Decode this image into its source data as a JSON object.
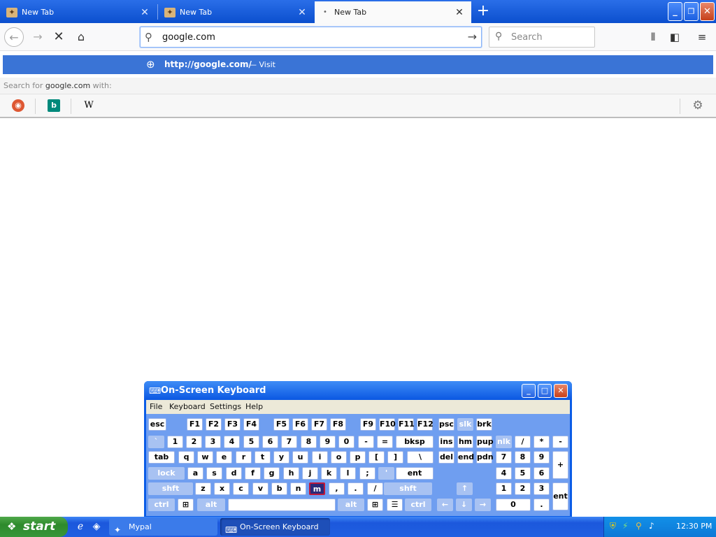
{
  "browser": {
    "tabs": [
      {
        "title": "New Tab",
        "active": false
      },
      {
        "title": "New Tab",
        "active": false
      },
      {
        "title": "New Tab",
        "active": true
      }
    ],
    "new_tab_symbol": "+",
    "url_value": "google.com",
    "search_placeholder": "Search",
    "suggestion_url": "http://google.com/",
    "suggestion_action": "— Visit",
    "search_with_prefix": "Search for",
    "search_with_term": "google.com",
    "search_with_suffix": "with:",
    "engines": [
      {
        "name": "duckduckgo-icon",
        "glyph": "◉",
        "color": "#de5833"
      },
      {
        "name": "bing-icon",
        "glyph": "b",
        "color": "#00897b"
      },
      {
        "name": "wikipedia-icon",
        "glyph": "W",
        "color": "#000000"
      }
    ]
  },
  "osk": {
    "title": "On-Screen Keyboard",
    "menu": [
      "File",
      "Keyboard",
      "Settings",
      "Help"
    ],
    "rows": [
      [
        "esc",
        "F1",
        "F2",
        "F3",
        "F4",
        "F5",
        "F6",
        "F7",
        "F8",
        "F9",
        "F10",
        "F11",
        "F12",
        "psc",
        "slk",
        "brk"
      ],
      [
        "`",
        "1",
        "2",
        "3",
        "4",
        "5",
        "6",
        "7",
        "8",
        "9",
        "0",
        "-",
        "=",
        "bksp",
        "ins",
        "hm",
        "pup",
        "nlk",
        "/",
        "*",
        "-"
      ],
      [
        "tab",
        "q",
        "w",
        "e",
        "r",
        "t",
        "y",
        "u",
        "i",
        "o",
        "p",
        "[",
        "]",
        "\\",
        "del",
        "end",
        "pdn",
        "7",
        "8",
        "9",
        "+"
      ],
      [
        "lock",
        "a",
        "s",
        "d",
        "f",
        "g",
        "h",
        "j",
        "k",
        "l",
        ";",
        "'",
        "ent",
        "4",
        "5",
        "6"
      ],
      [
        "shft",
        "z",
        "x",
        "c",
        "v",
        "b",
        "n",
        "m",
        ",",
        ".",
        "/",
        "shft",
        "↑",
        "1",
        "2",
        "3",
        "ent"
      ],
      [
        "ctrl",
        "⊞",
        "alt",
        "",
        "alt",
        "⊞",
        "☰",
        "ctrl",
        "←",
        "↓",
        "→",
        "0",
        "."
      ]
    ],
    "pressed_key": "m"
  },
  "taskbar": {
    "start_label": "start",
    "buttons": [
      "Mypal",
      "On-Screen Keyboard"
    ],
    "clock": "12:30 PM"
  }
}
